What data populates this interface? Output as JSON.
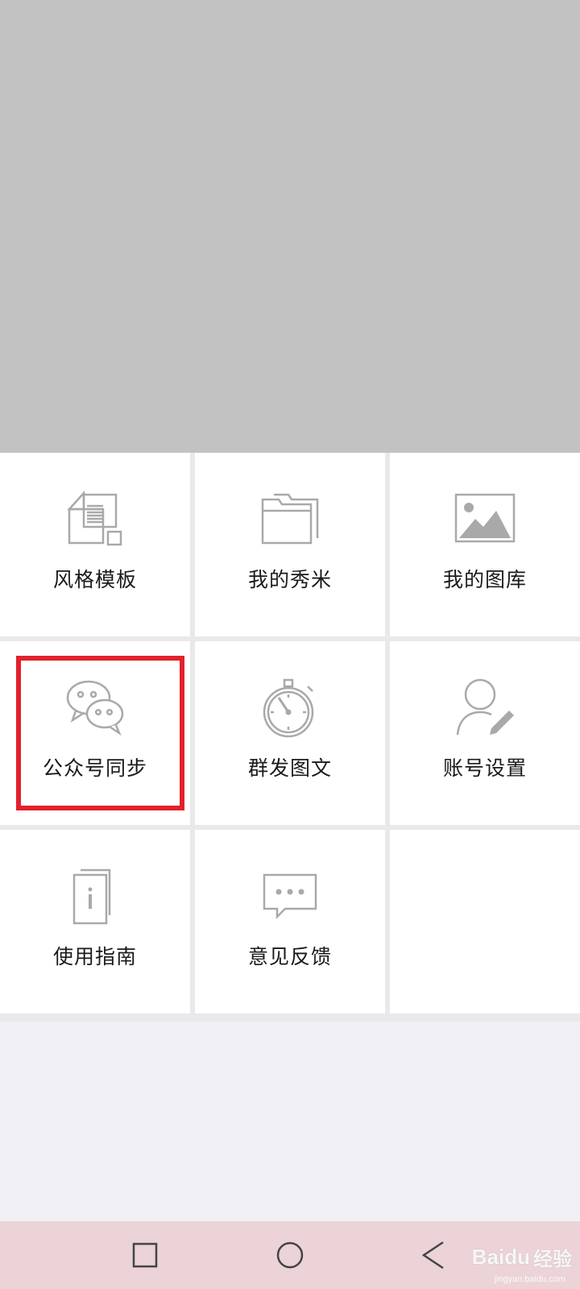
{
  "menu": {
    "items": [
      {
        "label": "风格模板",
        "icon": "template-icon"
      },
      {
        "label": "我的秀米",
        "icon": "folder-icon"
      },
      {
        "label": "我的图库",
        "icon": "image-gallery-icon"
      },
      {
        "label": "公众号同步",
        "icon": "wechat-icon"
      },
      {
        "label": "群发图文",
        "icon": "stopwatch-icon"
      },
      {
        "label": "账号设置",
        "icon": "user-edit-icon"
      },
      {
        "label": "使用指南",
        "icon": "guide-book-icon"
      },
      {
        "label": "意见反馈",
        "icon": "feedback-icon"
      }
    ]
  },
  "highlight": {
    "color": "#e2212a",
    "target": "公众号同步"
  },
  "nav_bar": {
    "buttons": [
      "recent-apps-icon",
      "home-icon",
      "back-icon"
    ]
  },
  "watermark": {
    "logo": "Bai",
    "logo_suffix": "du",
    "text": "经验",
    "url": "jingyan.baidu.com"
  },
  "colors": {
    "banner": "#c2c2c2",
    "icon_gray": "#a9a9a9",
    "background": "#efeff4"
  }
}
